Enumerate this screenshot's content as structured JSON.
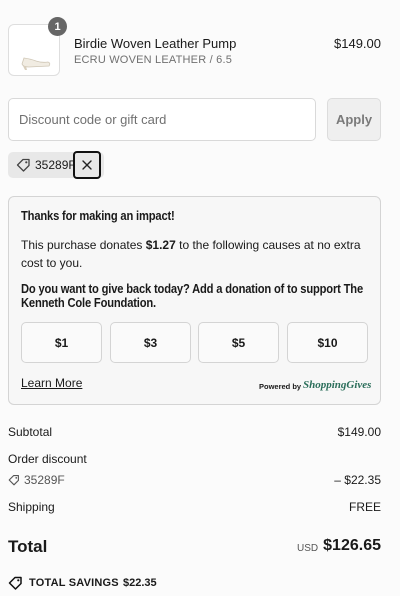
{
  "product": {
    "quantity": "1",
    "name": "Birdie Woven Leather Pump",
    "variant": "ECRU WOVEN LEATHER / 6.5",
    "price": "$149.00"
  },
  "discount": {
    "placeholder": "Discount code or gift card",
    "apply_label": "Apply",
    "applied_code": "35289F"
  },
  "donation": {
    "title": "Thanks for making an impact!",
    "text_before": "This purchase donates ",
    "amount": "$1.27",
    "text_after": " to the following causes at no extra cost to you.",
    "question": "Do you want to give back today? Add a donation of to support The Kenneth Cole Foundation.",
    "options": [
      "$1",
      "$3",
      "$5",
      "$10"
    ],
    "learn_more": "Learn More",
    "powered_by": "Powered by",
    "partner": "ShoppingGives"
  },
  "summary": {
    "subtotal_label": "Subtotal",
    "subtotal_value": "$149.00",
    "order_discount_label": "Order discount",
    "discount_code": "35289F",
    "discount_value": "– $22.35",
    "shipping_label": "Shipping",
    "shipping_value": "FREE",
    "total_label": "Total",
    "currency": "USD",
    "total_value": "$126.65",
    "savings_label": "TOTAL SAVINGS",
    "savings_value": "$22.35"
  },
  "colors": {
    "accent_logo": "#2a6e5a",
    "focus_border": "#111111"
  }
}
